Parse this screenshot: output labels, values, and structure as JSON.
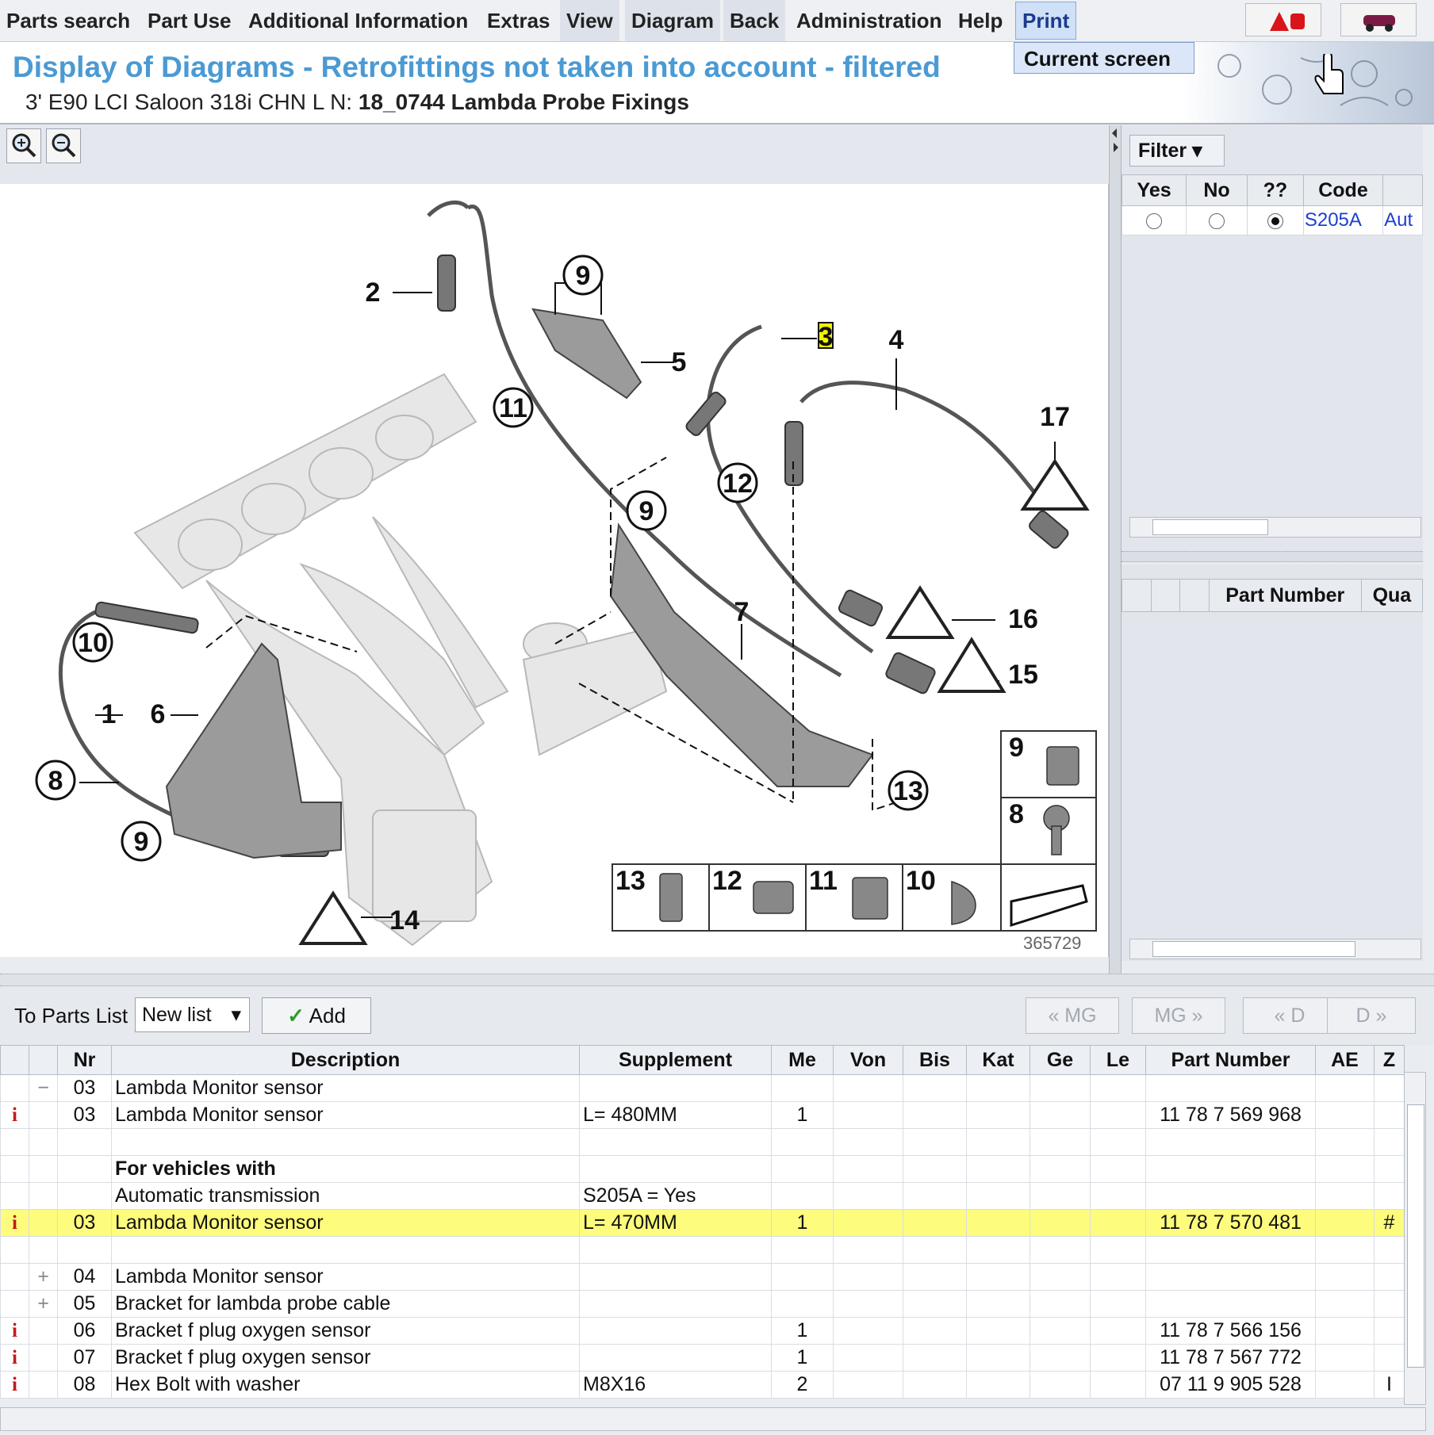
{
  "menu": {
    "items": [
      "Parts search",
      "Part Use",
      "Additional Information",
      "Extras",
      "View",
      "Diagram",
      "Back",
      "Administration",
      "Help",
      "Print"
    ],
    "print_dropdown": "Current screen"
  },
  "header": {
    "title": "Display of Diagrams - Retrofittings not taken into account - filtered",
    "vehicle": "3' E90 LCI Saloon 318i CHN  L N: ",
    "group": "18_0744 Lambda Probe Fixings"
  },
  "diagram": {
    "zoom_in_icon": "zoom-in-icon",
    "zoom_out_icon": "zoom-out-icon",
    "image_number": "365729",
    "callouts": [
      "1",
      "2",
      "3",
      "4",
      "5",
      "6",
      "7",
      "8",
      "9",
      "10",
      "11",
      "12",
      "13",
      "14",
      "15",
      "16",
      "17"
    ],
    "legend": [
      "13",
      "12",
      "11",
      "10",
      "9",
      "8"
    ]
  },
  "filter": {
    "button_label": "Filter",
    "columns": [
      "Yes",
      "No",
      "??",
      "Code"
    ],
    "row": {
      "code": "S205A",
      "extra": "Aut",
      "selected": "??"
    }
  },
  "parts_panel": {
    "columns": [
      "Part Number",
      "Qua"
    ]
  },
  "parts_toolbar": {
    "label": "To Parts List",
    "list_value": "New list",
    "add_label": "Add",
    "nav": [
      "« MG",
      "MG »",
      "« D",
      "D »"
    ]
  },
  "grid": {
    "columns": [
      "Nr",
      "Description",
      "Supplement",
      "Me",
      "Von",
      "Bis",
      "Kat",
      "Ge",
      "Le",
      "Part Number",
      "AE",
      "Z"
    ],
    "rows": [
      {
        "icon": "",
        "tree": "−",
        "nr": "03",
        "desc": "Lambda Monitor sensor",
        "supp": "",
        "me": "",
        "pn": "",
        "z": ""
      },
      {
        "icon": "i",
        "tree": "",
        "nr": "03",
        "desc": "Lambda Monitor sensor",
        "supp": "L= 480MM",
        "me": "1",
        "pn": "11 78 7 569 968",
        "z": ""
      },
      {
        "icon": "",
        "tree": "",
        "nr": "",
        "desc": "",
        "supp": "",
        "me": "",
        "pn": "",
        "z": ""
      },
      {
        "icon": "",
        "tree": "",
        "nr": "",
        "desc": "For vehicles with",
        "supp": "",
        "me": "",
        "pn": "",
        "z": "",
        "bold": true
      },
      {
        "icon": "",
        "tree": "",
        "nr": "",
        "desc": "Automatic transmission",
        "supp": "S205A = Yes",
        "me": "",
        "pn": "",
        "z": ""
      },
      {
        "icon": "i",
        "tree": "",
        "nr": "03",
        "desc": "Lambda Monitor sensor",
        "supp": "L= 470MM",
        "me": "1",
        "pn": "11 78 7 570 481",
        "z": "#",
        "highlight": true
      },
      {
        "icon": "",
        "tree": "",
        "nr": "",
        "desc": "",
        "supp": "",
        "me": "",
        "pn": "",
        "z": ""
      },
      {
        "icon": "",
        "tree": "+",
        "nr": "04",
        "desc": "Lambda Monitor sensor",
        "supp": "",
        "me": "",
        "pn": "",
        "z": ""
      },
      {
        "icon": "",
        "tree": "+",
        "nr": "05",
        "desc": "Bracket for lambda probe cable",
        "supp": "",
        "me": "",
        "pn": "",
        "z": ""
      },
      {
        "icon": "i",
        "tree": "",
        "nr": "06",
        "desc": "Bracket f plug oxygen sensor",
        "supp": "",
        "me": "1",
        "pn": "11 78 7 566 156",
        "z": ""
      },
      {
        "icon": "i",
        "tree": "",
        "nr": "07",
        "desc": "Bracket f plug oxygen sensor",
        "supp": "",
        "me": "1",
        "pn": "11 78 7 567 772",
        "z": ""
      },
      {
        "icon": "i",
        "tree": "",
        "nr": "08",
        "desc": "Hex Bolt with washer",
        "supp": "M8X16",
        "me": "2",
        "pn": "07 11 9 905 528",
        "z": "I"
      }
    ]
  }
}
